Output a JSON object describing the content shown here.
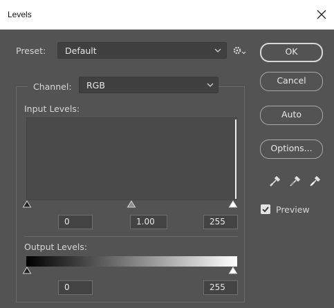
{
  "window": {
    "title": "Levels"
  },
  "preset": {
    "label": "Preset:",
    "value": "Default"
  },
  "channel": {
    "label": "Channel:",
    "value": "RGB"
  },
  "input_levels": {
    "label": "Input Levels:",
    "black": "0",
    "gamma": "1.00",
    "white": "255"
  },
  "output_levels": {
    "label": "Output Levels:",
    "black": "0",
    "white": "255"
  },
  "buttons": {
    "ok": "OK",
    "cancel": "Cancel",
    "auto": "Auto",
    "options": "Options..."
  },
  "preview": {
    "label": "Preview",
    "checked": true
  },
  "icons": {
    "close": "close-icon",
    "chevron": "chevron-down-icon",
    "gear": "gear-icon",
    "eyedroppers": [
      "black-point-eyedropper-icon",
      "gray-point-eyedropper-icon",
      "white-point-eyedropper-icon"
    ]
  },
  "colors": {
    "panel": "#535353",
    "histogram": "#4a4a4a"
  }
}
